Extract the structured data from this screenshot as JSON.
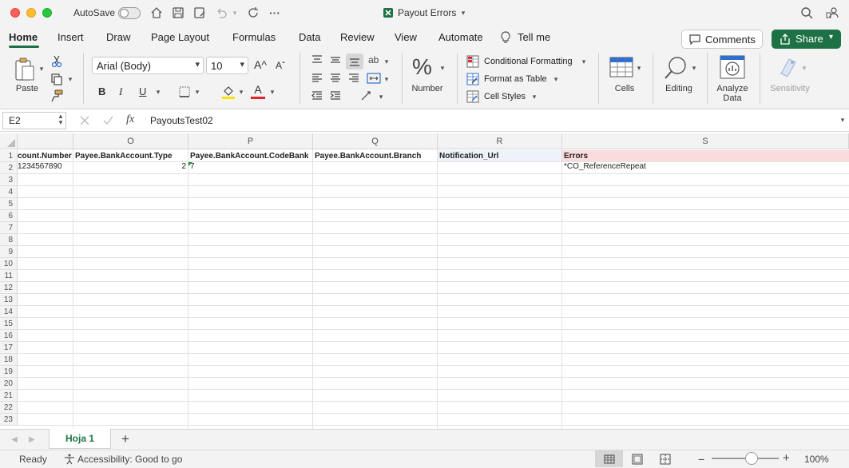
{
  "titlebar": {
    "autosave_label": "AutoSave",
    "doc_title": "Payout Errors",
    "colors": {
      "excel_green": "#1e7145"
    }
  },
  "tabs": [
    "Home",
    "Insert",
    "Draw",
    "Page Layout",
    "Formulas",
    "Data",
    "Review",
    "View",
    "Automate"
  ],
  "tell_me": "Tell me",
  "comments_label": "Comments",
  "share_label": "Share",
  "ribbon": {
    "paste_label": "Paste",
    "font_name": "Arial (Body)",
    "font_size": "10",
    "number_label": "Number",
    "conditional_formatting": "Conditional Formatting",
    "format_as_table": "Format as Table",
    "cell_styles": "Cell Styles",
    "cells_label": "Cells",
    "editing_label": "Editing",
    "analyze_data_line1": "Analyze",
    "analyze_data_line2": "Data",
    "sensitivity_label": "Sensitivity",
    "bold_glyph": "B",
    "italic_glyph": "I",
    "underline_glyph": "U",
    "grow_font_glyph": "A^",
    "shrink_font_glyph": "Aˇ",
    "font_color_glyph": "A",
    "percent_glyph": "%",
    "wrap_glyph": "ab"
  },
  "formula_bar": {
    "name_box": "E2",
    "fx": "fx",
    "value": "PayoutsTest02"
  },
  "grid": {
    "columns": [
      "",
      "O",
      "P",
      "Q",
      "R",
      "S"
    ],
    "rows": [
      "1",
      "2",
      "3",
      "4",
      "5",
      "6",
      "7",
      "8",
      "9",
      "10",
      "11",
      "12",
      "13",
      "14",
      "15",
      "16",
      "17",
      "18",
      "19",
      "20",
      "21",
      "22",
      "23"
    ],
    "row1": [
      "count.Number",
      "Payee.BankAccount.Type",
      "Payee.BankAccount.CodeBank",
      "Payee.BankAccount.Branch",
      "Notification_Url",
      "Errors"
    ],
    "row2": [
      "1234567890",
      "2",
      "7",
      "",
      "",
      "*CO_ReferenceRepeat"
    ]
  },
  "sheets": {
    "active": "Hoja 1",
    "add": "+"
  },
  "status": {
    "ready": "Ready",
    "accessibility": "Accessibility: Good to go",
    "zoom": "100%",
    "zoom_value_percent": 100
  }
}
